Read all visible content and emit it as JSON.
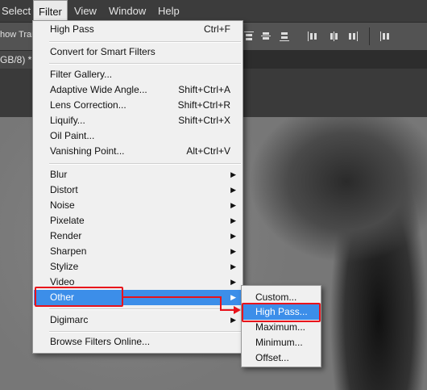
{
  "menubar": {
    "items": [
      {
        "label": "Select"
      },
      {
        "label": "Filter"
      },
      {
        "label": "View"
      },
      {
        "label": "Window"
      },
      {
        "label": "Help"
      }
    ]
  },
  "optionsbar": {
    "partial_label": "how Trans"
  },
  "tab": {
    "label": "GB/8) *"
  },
  "filter_menu": {
    "items": [
      {
        "label": "High Pass",
        "shortcut": "Ctrl+F"
      },
      {
        "label": "Convert for Smart Filters",
        "shortcut": ""
      },
      {
        "label": "Filter Gallery...",
        "shortcut": ""
      },
      {
        "label": "Adaptive Wide Angle...",
        "shortcut": "Shift+Ctrl+A"
      },
      {
        "label": "Lens Correction...",
        "shortcut": "Shift+Ctrl+R"
      },
      {
        "label": "Liquify...",
        "shortcut": "Shift+Ctrl+X"
      },
      {
        "label": "Oil Paint...",
        "shortcut": ""
      },
      {
        "label": "Vanishing Point...",
        "shortcut": "Alt+Ctrl+V"
      },
      {
        "label": "Blur",
        "shortcut": ""
      },
      {
        "label": "Distort",
        "shortcut": ""
      },
      {
        "label": "Noise",
        "shortcut": ""
      },
      {
        "label": "Pixelate",
        "shortcut": ""
      },
      {
        "label": "Render",
        "shortcut": ""
      },
      {
        "label": "Sharpen",
        "shortcut": ""
      },
      {
        "label": "Stylize",
        "shortcut": ""
      },
      {
        "label": "Video",
        "shortcut": ""
      },
      {
        "label": "Other",
        "shortcut": ""
      },
      {
        "label": "Digimarc",
        "shortcut": ""
      },
      {
        "label": "Browse Filters Online...",
        "shortcut": ""
      }
    ]
  },
  "other_submenu": {
    "items": [
      {
        "label": "Custom..."
      },
      {
        "label": "High Pass..."
      },
      {
        "label": "Maximum..."
      },
      {
        "label": "Minimum..."
      },
      {
        "label": "Offset..."
      }
    ]
  },
  "colors": {
    "highlight": "#3c8ee9",
    "annotation": "#e8131b",
    "menu_bg": "#f0f0f0"
  },
  "icons": {
    "submenu_arrow": "triangle-right-icon",
    "align_buttons": "align-icon"
  }
}
